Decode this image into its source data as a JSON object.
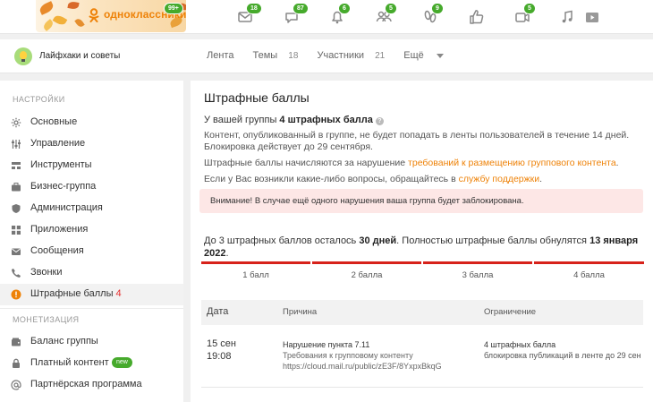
{
  "topbar": {
    "logo_text": "одноклассники",
    "logo_badge": "99+",
    "nav": [
      {
        "name": "messages-icon",
        "badge": "18"
      },
      {
        "name": "discussions-icon",
        "badge": "87"
      },
      {
        "name": "notifications-icon",
        "badge": "6"
      },
      {
        "name": "friends-icon",
        "badge": "5"
      },
      {
        "name": "guests-icon",
        "badge": "9"
      },
      {
        "name": "events-icon",
        "badge": ""
      },
      {
        "name": "video-icon",
        "badge": "5"
      },
      {
        "name": "music-icon",
        "badge": ""
      },
      {
        "name": "play-icon",
        "badge": ""
      }
    ]
  },
  "group": {
    "name": "Лайфхаки и советы",
    "tabs": [
      {
        "label": "Лента",
        "count": ""
      },
      {
        "label": "Темы",
        "count": "18"
      },
      {
        "label": "Участники",
        "count": "21"
      },
      {
        "label": "Ещё",
        "count": ""
      }
    ]
  },
  "sidebar": {
    "settings_header": "НАСТРОЙКИ",
    "items": [
      {
        "label": "Основные",
        "icon": "gear-icon"
      },
      {
        "label": "Управление",
        "icon": "sliders-icon"
      },
      {
        "label": "Инструменты",
        "icon": "tools-icon"
      },
      {
        "label": "Бизнес-группа",
        "icon": "briefcase-icon"
      },
      {
        "label": "Администрация",
        "icon": "shield-icon"
      },
      {
        "label": "Приложения",
        "icon": "apps-icon"
      },
      {
        "label": "Сообщения",
        "icon": "mail-icon"
      },
      {
        "label": "Звонки",
        "icon": "phone-icon"
      },
      {
        "label": "Штрафные баллы",
        "count": "4",
        "icon": "warning-icon"
      }
    ],
    "monetization_header": "МОНЕТИЗАЦИЯ",
    "money_items": [
      {
        "label": "Баланс группы",
        "icon": "wallet-icon"
      },
      {
        "label": "Платный контент",
        "pill": "new",
        "icon": "lock-icon"
      },
      {
        "label": "Партнёрская программа",
        "icon": "at-icon"
      }
    ]
  },
  "main": {
    "title": "Штрафные баллы",
    "summary_prefix": "У вашей группы ",
    "summary_bold": "4 штрафных балла",
    "desc_line1": "Контент, опубликованный в группе, не будет попадать в ленты пользователей в течение 14 дней.",
    "desc_line2": "Блокировка действует до 29 сентября.",
    "rules_prefix": "Штрафные баллы начисляются за нарушение ",
    "rules_link": "требований к размещению группового контента",
    "rules_suffix": ".",
    "support_prefix": "Если у Вас возникли какие-либо вопросы, обращайтесь в ",
    "support_link": "службу поддержки",
    "support_suffix": ".",
    "alert": "Внимание! В случае ещё одного нарушения ваша группа будет заблокирована.",
    "days_prefix": "До 3 штрафных баллов осталось ",
    "days_bold": "30 дней",
    "days_mid": ". Полностью штрафные баллы обнулятся ",
    "days_date": "13 января 2022",
    "days_suffix": ".",
    "strikes": [
      "1 балл",
      "2 балла",
      "3 балла",
      "4 балла"
    ],
    "strikes_active": 4,
    "table": {
      "headers": {
        "date": "Дата",
        "reason": "Причина",
        "limit": "Ограничение"
      },
      "rows": [
        {
          "date": "15 сен",
          "time": "19:08",
          "reason_title": "Нарушение пункта 7.11",
          "reason_sub": "Требования к групповому контенту",
          "reason_url": "https://cloud.mail.ru/public/zE3F/8YxpxBkqG",
          "limit_title": "4 штрафных балла",
          "limit_sub": "блокировка публикаций в ленте до 29 сен"
        }
      ]
    }
  },
  "colors": {
    "accent": "#ee8208",
    "badge": "#46aa2c",
    "danger": "#d7221a",
    "alert_bg": "#fde7e6"
  }
}
